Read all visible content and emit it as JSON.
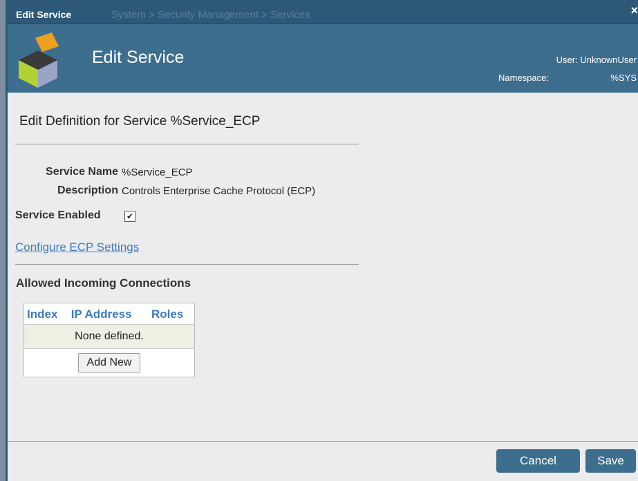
{
  "window": {
    "title": "Edit Service",
    "breadcrumb": "System > Security Management > Services",
    "close": "×"
  },
  "header": {
    "title": "Edit Service",
    "user": "User: UnknownUser",
    "namespace_label": "Namespace:",
    "namespace_value": "%SYS"
  },
  "form": {
    "definition_title": "Edit Definition for Service %Service_ECP",
    "service_name_label": "Service Name",
    "service_name_value": "%Service_ECP",
    "description_label": "Description",
    "description_value": "Controls Enterprise Cache Protocol (ECP)",
    "enabled_label": "Service Enabled",
    "enabled_checked": "✔",
    "configure_link": "Configure ECP Settings"
  },
  "connections": {
    "title": "Allowed Incoming Connections",
    "columns": [
      "Index",
      "IP Address",
      "Roles"
    ],
    "empty_text": "None defined.",
    "add_button": "Add New"
  },
  "footer": {
    "cancel": "Cancel",
    "save": "Save"
  },
  "colors": {
    "titlebar": "#2e5878",
    "header": "#3e6e8e",
    "link": "#3a7bbf",
    "button": "#3e6e8e"
  }
}
